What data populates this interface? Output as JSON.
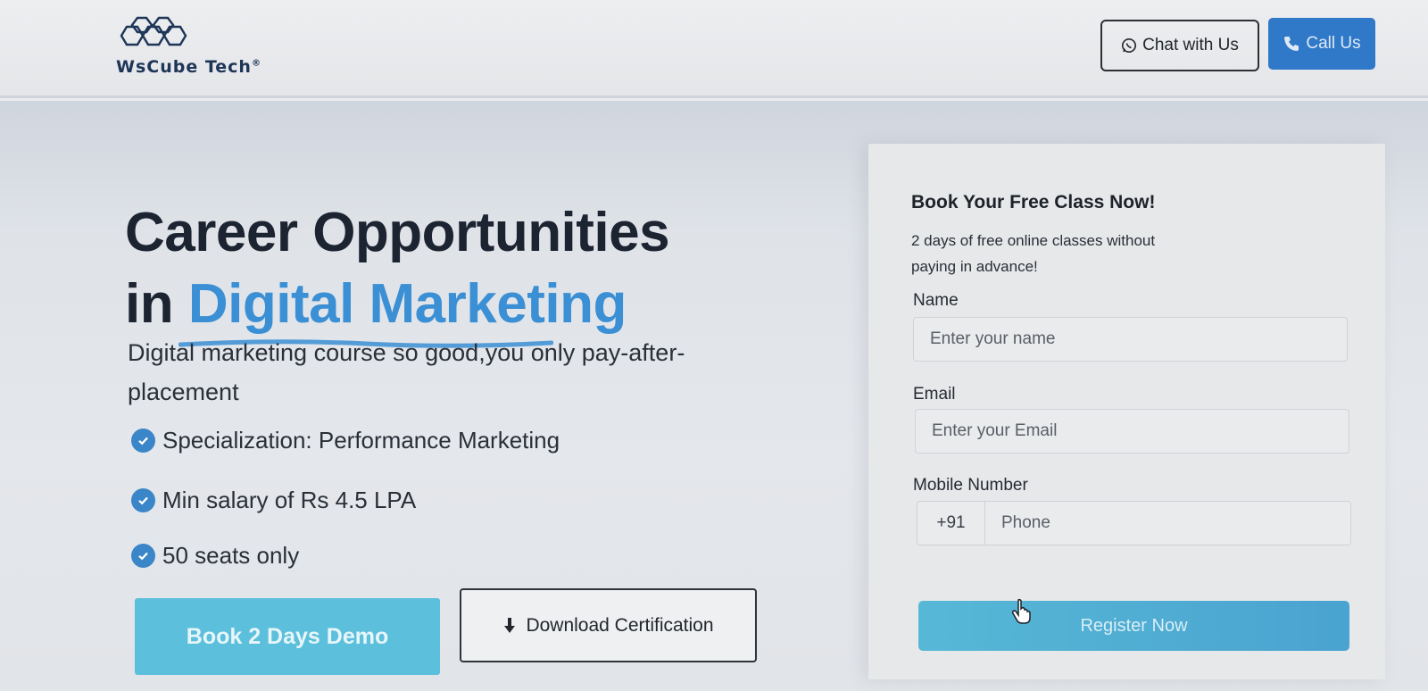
{
  "header": {
    "logo_text": "WsCube Tech",
    "logo_mark": "®",
    "chat_label": "Chat with Us",
    "call_label": "Call Us"
  },
  "hero": {
    "title_line1": "Career Opportunities",
    "title_line2_prefix": "in",
    "title_line2_highlight": "Digital Marketing",
    "subtitle": "Digital marketing course so good,you only pay-after-placement",
    "features": [
      "Specialization: Performance Marketing",
      "Min salary of Rs 4.5 LPA",
      "50 seats only"
    ],
    "demo_button": "Book 2 Days Demo",
    "download_button": "Download Certification"
  },
  "form": {
    "title": "Book Your Free Class Now!",
    "description": "2 days of free online classes without paying in advance!",
    "name_label": "Name",
    "name_placeholder": "Enter your name",
    "email_label": "Email",
    "email_placeholder": "Enter your Email",
    "mobile_label": "Mobile Number",
    "phone_prefix": "+91",
    "phone_placeholder": "Phone",
    "submit_label": "Register Now"
  },
  "colors": {
    "accent_blue": "#2f79c8",
    "highlight_blue": "#3b8fd4",
    "cta_cyan": "#5cc0dc",
    "check_blue": "#3a86c9"
  },
  "icons": {
    "chat": "whatsapp-icon",
    "call": "phone-icon",
    "check": "check-circle-icon",
    "download": "download-arrow-icon",
    "cursor": "hand-pointer-cursor-icon"
  }
}
